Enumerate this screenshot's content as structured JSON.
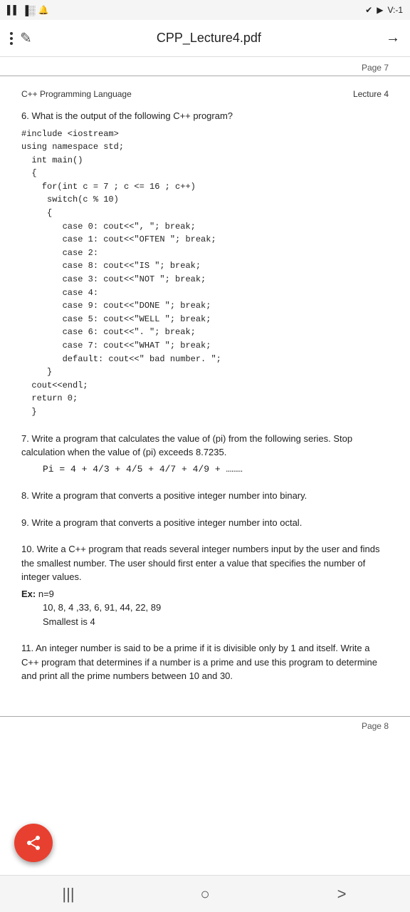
{
  "status_bar": {
    "signal": "▌▌▌",
    "wifi": "wifi",
    "sound": "🔔",
    "check": "✔",
    "video": "▶",
    "battery": "V:-1"
  },
  "toolbar": {
    "menu_label": "⋮",
    "pencil_label": "✎",
    "title": "CPP_Lecture4.pdf",
    "arrow_label": "→"
  },
  "page_top": "Page 7",
  "page_bottom": "Page 8",
  "section_header": {
    "left": "C++ Programming Language",
    "right": "Lecture 4"
  },
  "questions": [
    {
      "number": "6.",
      "text": "What is the output of the following C++ program?",
      "code": "#include <iostream>\nusing namespace std;\n  int main()\n  {\n    for(int c = 7 ; c <= 16 ; c++)\n     switch(c % 10)\n     {\n        case 0: cout<<\", \"; break;\n        case 1: cout<<\"OFTEN \"; break;\n        case 2:\n        case 8: cout<<\"IS \"; break;\n        case 3: cout<<\"NOT \"; break;\n        case 4:\n        case 9: cout<<\"DONE \"; break;\n        case 5: cout<<\"WELL \"; break;\n        case 6: cout<<\". \"; break;\n        case 7: cout<<\"WHAT \"; break;\n        default: cout<<\" bad number. \";\n     }\n  cout<<endl;\n  return 0;\n  }"
    },
    {
      "number": "7.",
      "text": "Write a program that calculates the value of (pi) from the following series. Stop calculation when the value of (pi) exceeds 8.7235.",
      "formula": "Pi = 4 + 4/3 + 4/5 + 4/7 + 4/9 + ………"
    },
    {
      "number": "8.",
      "text": "Write a program that converts a positive integer number into binary."
    },
    {
      "number": "9.",
      "text": "Write a program that converts a positive integer number into octal."
    },
    {
      "number": "10.",
      "text": "Write a C++ program that reads several integer numbers input by the user and finds the smallest number. The user should first enter a value that specifies the number of integer values.",
      "example_label": "Ex:",
      "example_n": "n=9",
      "example_values": "10, 8, 4 ,33, 6, 91, 44, 22, 89",
      "example_result": "Smallest is  4"
    },
    {
      "number": "11.",
      "text": "An integer number is said to be a prime if it is divisible only by 1 and itself. Write a C++ program that determines if a number is a prime and use this program to determine and print all the prime numbers between 10 and 30."
    }
  ],
  "fab": {
    "icon_label": "share-icon"
  },
  "bottom_nav": {
    "menu_icon": "|||",
    "home_icon": "○",
    "back_icon": ">"
  }
}
